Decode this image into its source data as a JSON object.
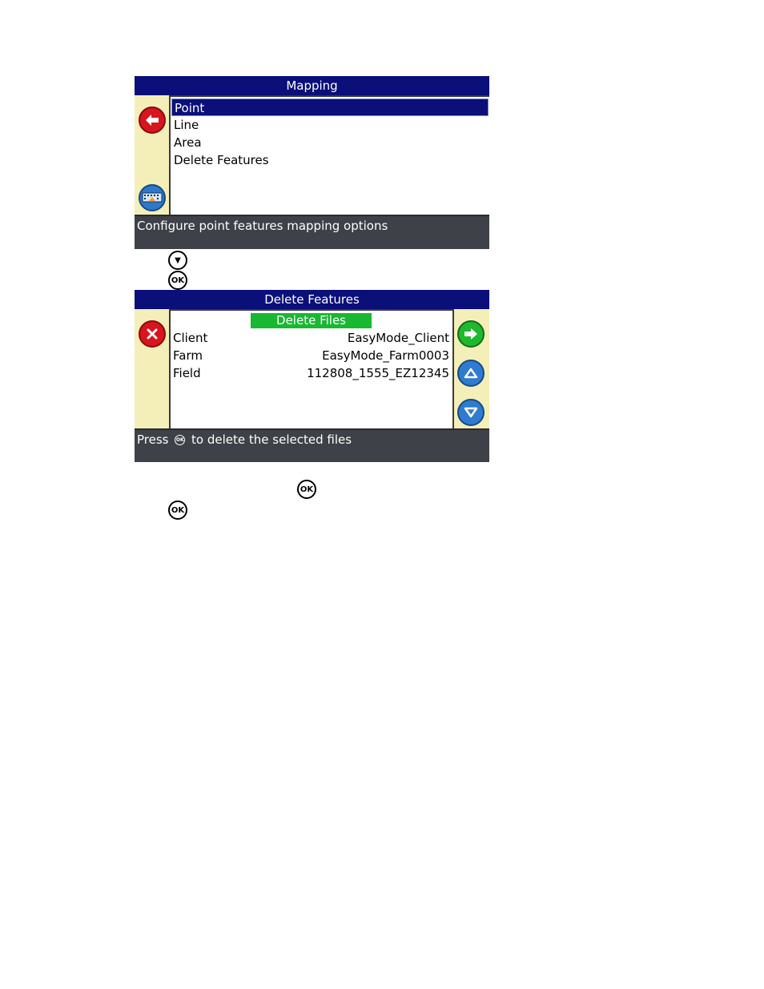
{
  "screen1": {
    "title": "Mapping",
    "menu_items": [
      "Point",
      "Line",
      "Area",
      "Delete Features"
    ],
    "status": "Configure point features mapping options",
    "icons": [
      "back-arrow-icon",
      "keyboard-icon"
    ]
  },
  "steps": {
    "down_key": "▼",
    "ok_key": "OK"
  },
  "screen2": {
    "title": "Delete Features",
    "header": "Delete Files",
    "rows": [
      {
        "label": "Client",
        "value": "EasyMode_Client"
      },
      {
        "label": "Farm",
        "value": "EasyMode_Farm0003"
      },
      {
        "label": "Field",
        "value": "112808_1555_EZ12345"
      }
    ],
    "status_before": "Press",
    "status_inline_key": "OK",
    "status_after": "to delete the selected files",
    "icons": [
      "close-icon",
      "next-arrow-icon",
      "up-arrow-icon",
      "down-arrow-icon"
    ]
  },
  "colors": {
    "title_bar": "#0a0f7a",
    "side_panel": "#f4efb8",
    "status_bar": "#3e4147",
    "highlight_green": "#18b832"
  }
}
